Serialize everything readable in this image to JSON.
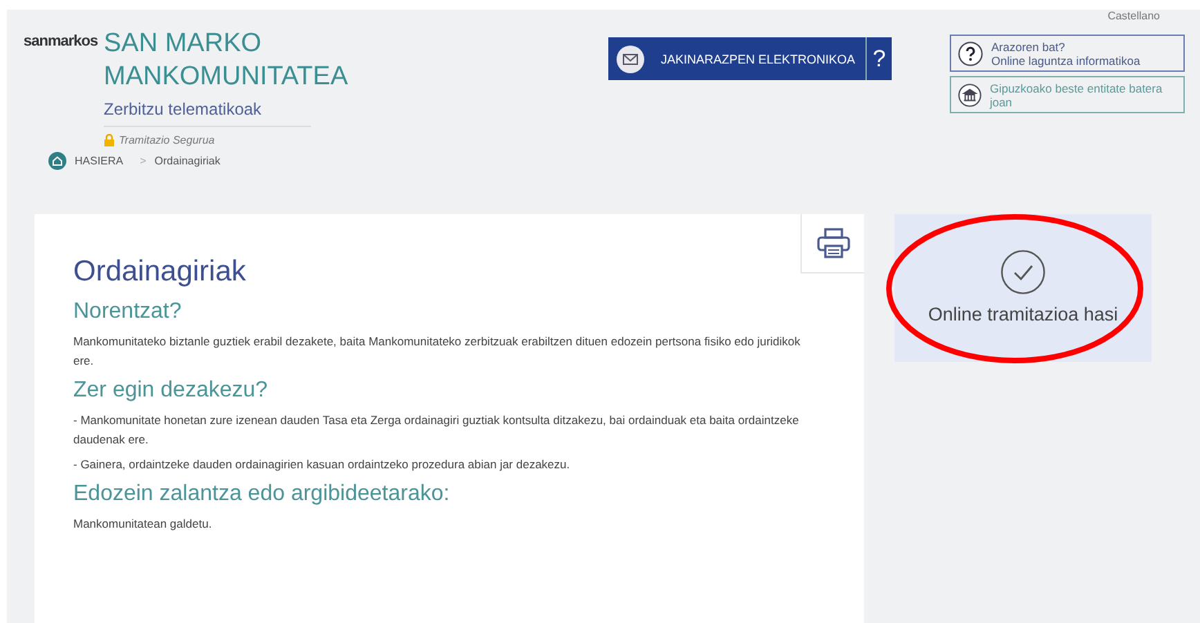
{
  "language_link": "Castellano",
  "logo": {
    "text": "sanmarkos"
  },
  "site": {
    "title": "SAN MARKO MANKOMUNITATEA",
    "subtitle": "Zerbitzu telematikoak",
    "secure": "Tramitazio Segurua"
  },
  "notification_button": {
    "label": "JAKINARAZPEN ELEKTRONIKOA",
    "help": "?"
  },
  "help_links": [
    {
      "kind": "question",
      "lines": [
        "Arazoren bat?",
        "Online laguntza informatikoa"
      ]
    },
    {
      "kind": "bank",
      "lines": [
        "Gipuzkoako beste entitate batera joan"
      ]
    }
  ],
  "breadcrumb": [
    "HASIERA",
    "Ordainagiriak"
  ],
  "breadcrumb_separator": ">",
  "content": {
    "title": "Ordainagiriak",
    "sections": [
      {
        "heading": "Norentzat?",
        "paragraphs": [
          "Mankomunitateko biztanle guztiek erabil dezakete, baita Mankomunitateko zerbitzuak erabiltzen dituen edozein pertsona fisiko edo juridikok ere."
        ]
      },
      {
        "heading": "Zer egin dezakezu?",
        "paragraphs": [
          "- Mankomunitate honetan zure izenean dauden Tasa eta Zerga ordainagiri guztiak kontsulta ditzakezu, bai ordainduak eta baita ordaintzeke daudenak ere.",
          "- Gainera, ordaintzeke dauden ordainagirien kasuan ordaintzeko prozedura abian jar dezakezu."
        ]
      },
      {
        "heading": "Edozein zalantza edo argibideetarako:",
        "paragraphs": [
          "Mankomunitatean galdetu."
        ]
      }
    ]
  },
  "start_button": {
    "label": "Online tramitazioa hasi",
    "highlighted": true
  }
}
